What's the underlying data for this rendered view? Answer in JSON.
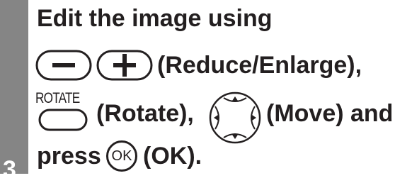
{
  "step": {
    "number": "3"
  },
  "instruction": {
    "line1": "Edit the image using",
    "reduce_enlarge_text": "(Reduce/Enlarge),",
    "rotate_label": "ROTATE",
    "rotate_text": "(Rotate),",
    "move_text": "(Move) and",
    "press_text": "press",
    "ok_button_text": "OK",
    "ok_text": "(OK)."
  },
  "colors": {
    "text": "#231f20",
    "step_bar": "#858585",
    "button_fill": "#ffffff"
  },
  "icons": [
    "minus-button-icon",
    "plus-button-icon",
    "rotate-button-icon",
    "move-joystick-icon",
    "ok-button-icon"
  ]
}
